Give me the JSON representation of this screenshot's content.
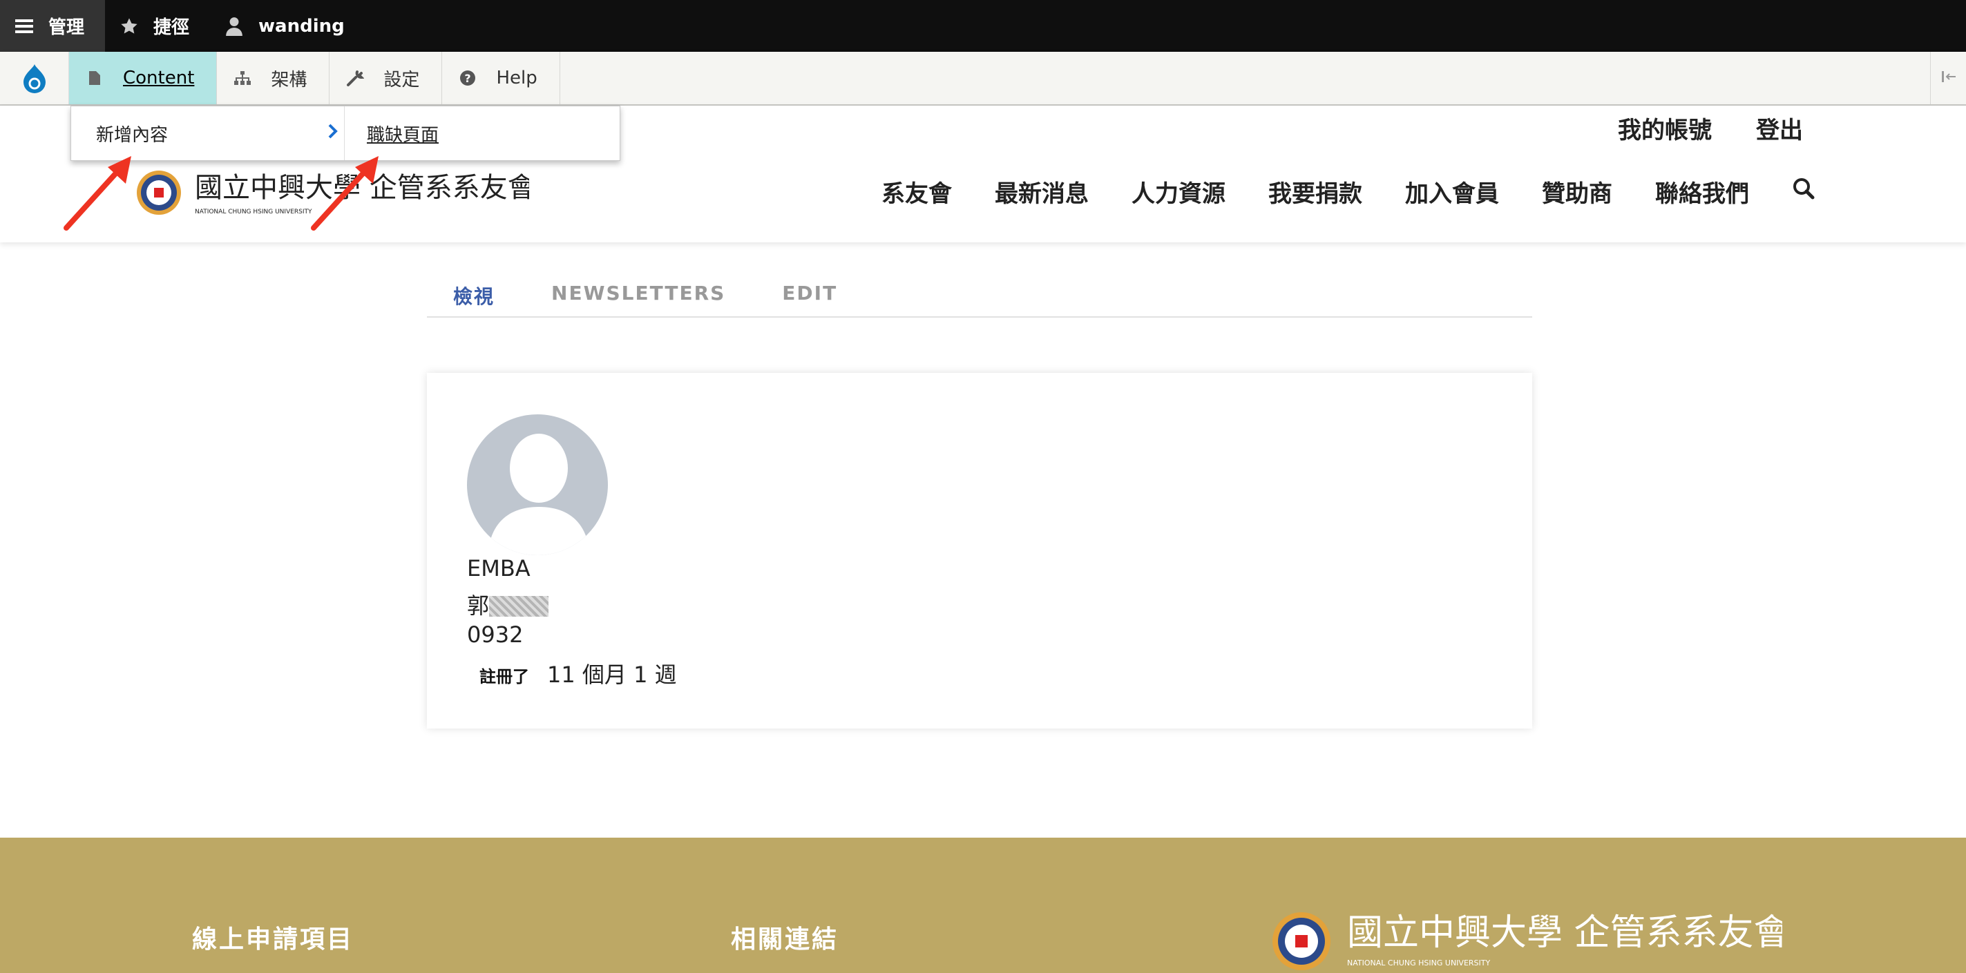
{
  "admin_bar": {
    "manage": "管理",
    "shortcuts": "捷徑",
    "user": "wanding"
  },
  "tray": {
    "items": [
      {
        "label": "Content",
        "icon": "file-icon",
        "active": true
      },
      {
        "label": "架構",
        "icon": "sitemap-icon"
      },
      {
        "label": "設定",
        "icon": "wrench-icon"
      },
      {
        "label": "Help",
        "icon": "help-icon"
      }
    ]
  },
  "dropdown": {
    "add_content": "新增內容",
    "job_page": "職缺頁面"
  },
  "header": {
    "my_account": "我的帳號",
    "logout": "登出",
    "logo_text": "國立中興大學 企管系系友會",
    "logo_sub": "NATIONAL CHUNG HSING UNIVERSITY",
    "nav": [
      "系友會",
      "最新消息",
      "人力資源",
      "我要捐款",
      "加入會員",
      "贊助商",
      "聯絡我們"
    ]
  },
  "tabs": {
    "view": "檢視",
    "newsletters": "NEWSLETTERS",
    "edit": "EDIT"
  },
  "profile": {
    "program": "EMBA",
    "surname": "郭",
    "phone": "0932",
    "member_for_label": "註冊了",
    "member_for_value": "11 個月 1 週"
  },
  "footer": {
    "apply_heading": "線上申請項目",
    "links_heading": "相關連結",
    "logo_text": "國立中興大學 企管系系友會",
    "logo_sub": "NATIONAL CHUNG HSING UNIVERSITY"
  },
  "colors": {
    "admin_bar": "#0f0f0f",
    "tray_active": "#b2e5e4",
    "tab_active": "#3b5da8",
    "footer": "#bda865",
    "arrow": "#ee3322"
  }
}
